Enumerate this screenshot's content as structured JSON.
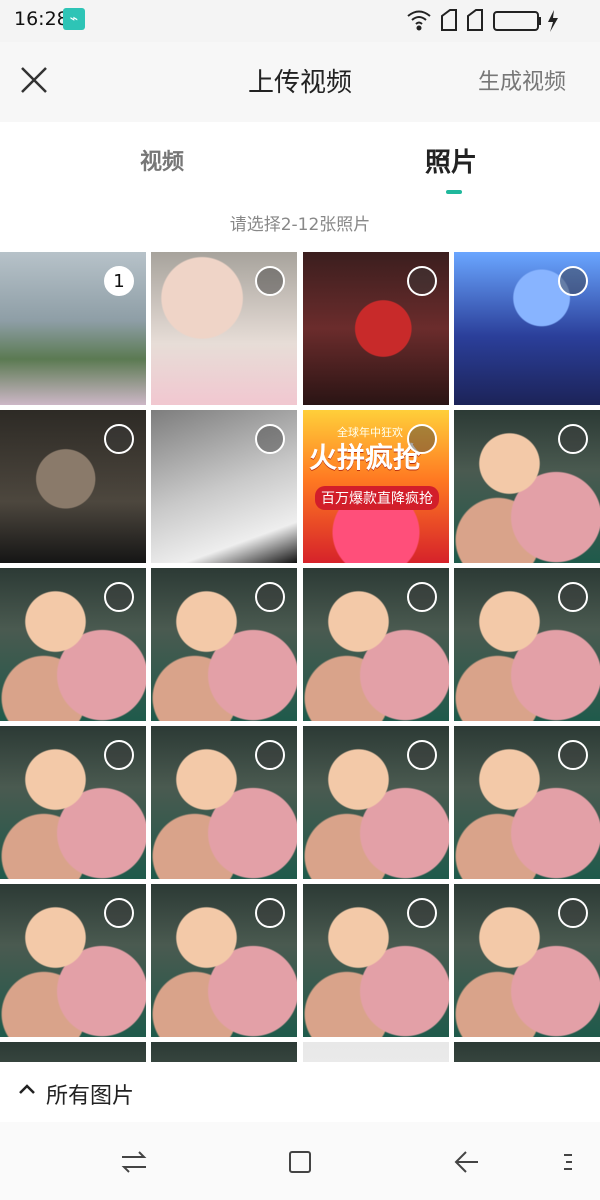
{
  "status_bar": {
    "time": "16:28"
  },
  "header": {
    "title": "上传视频",
    "generate_label": "生成视频"
  },
  "tabs": {
    "video": "视频",
    "photo": "照片"
  },
  "hint": "请选择2-12张照片",
  "grid": {
    "selected_badge": "1"
  },
  "bottom": {
    "album_label": "所有图片"
  },
  "promo": {
    "line0": "全球年中狂欢",
    "line1": "火拼疯抢",
    "line2": "百万爆款直降疯抢"
  }
}
